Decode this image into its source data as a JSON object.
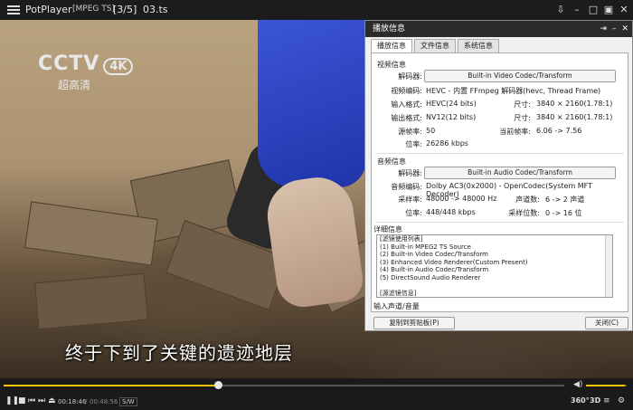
{
  "titlebar": {
    "app": "PotPlayer",
    "format": "[MPEG TS]",
    "position": "[3/5]",
    "filename": "03.ts"
  },
  "video": {
    "logo": "CCTV",
    "logo_4k": "4K",
    "logo_sub": "超高清",
    "subtitle": "终于下到了关键的遗迹地层"
  },
  "panel": {
    "title": "播放信息",
    "tabs": [
      "播放信息",
      "文件信息",
      "系统信息"
    ],
    "video_section": "视频信息",
    "video": {
      "decoder_label": "解码器:",
      "decoder_button": "Built-in Video Codec/Transform",
      "codec_label": "视频编码:",
      "codec_value": "HEVC - 内置 FFmpeg 解码器(hevc, Thread Frame)",
      "in_fmt_label": "输入格式:",
      "in_fmt_value": "HEVC(24 bits)",
      "in_size_label": "尺寸:",
      "in_size_value": "3840 × 2160(1.78:1)",
      "out_fmt_label": "输出格式:",
      "out_fmt_value": "NV12(12 bits)",
      "out_size_label": "尺寸:",
      "out_size_value": "3840 × 2160(1.78:1)",
      "src_fps_label": "源帧率:",
      "src_fps_value": "50",
      "cur_fps_label": "当前帧率:",
      "cur_fps_value": "6.06 -> 7.56",
      "bitrate_label": "位率:",
      "bitrate_value": "26286 kbps"
    },
    "audio_section": "音频信息",
    "audio": {
      "decoder_label": "解码器:",
      "decoder_button": "Built-in Audio Codec/Transform",
      "codec_label": "音频编码:",
      "codec_value": "Dolby AC3(0x2000) - OpenCodec(System MFT Decoder)",
      "rate_label": "采样率:",
      "rate_value": "48000 -> 48000 Hz",
      "ch_label": "声道数:",
      "ch_value": "6 -> 2 声道",
      "bitrate_label": "位率:",
      "bitrate_value": "448/448 kbps",
      "bits_label": "采样位数:",
      "bits_value": "0 -> 16 位"
    },
    "detail_section": "详细信息",
    "detail_lines": [
      "[滤镜使用列表]",
      "(1) Built-in MPEG2 TS Source",
      "(2) Built-in Video Codec/Transform",
      "(3) Enhanced Video Renderer(Custom Present)",
      "(4) Built-in Audio Codec/Transform",
      "(5) DirectSound Audio Renderer",
      "",
      "[源滤镜信息]"
    ],
    "io_section": "输入声道/音量",
    "copy_button": "复制到剪贴板(P)",
    "close_button": "关闭(C)"
  },
  "controls": {
    "current_time": "00:18:46",
    "total_time": "00:48:56",
    "sw_label": "S/W",
    "badge_360": "360°",
    "badge_3d": "3D",
    "seek_fraction": 0.383,
    "volume_fraction": 0.95
  }
}
